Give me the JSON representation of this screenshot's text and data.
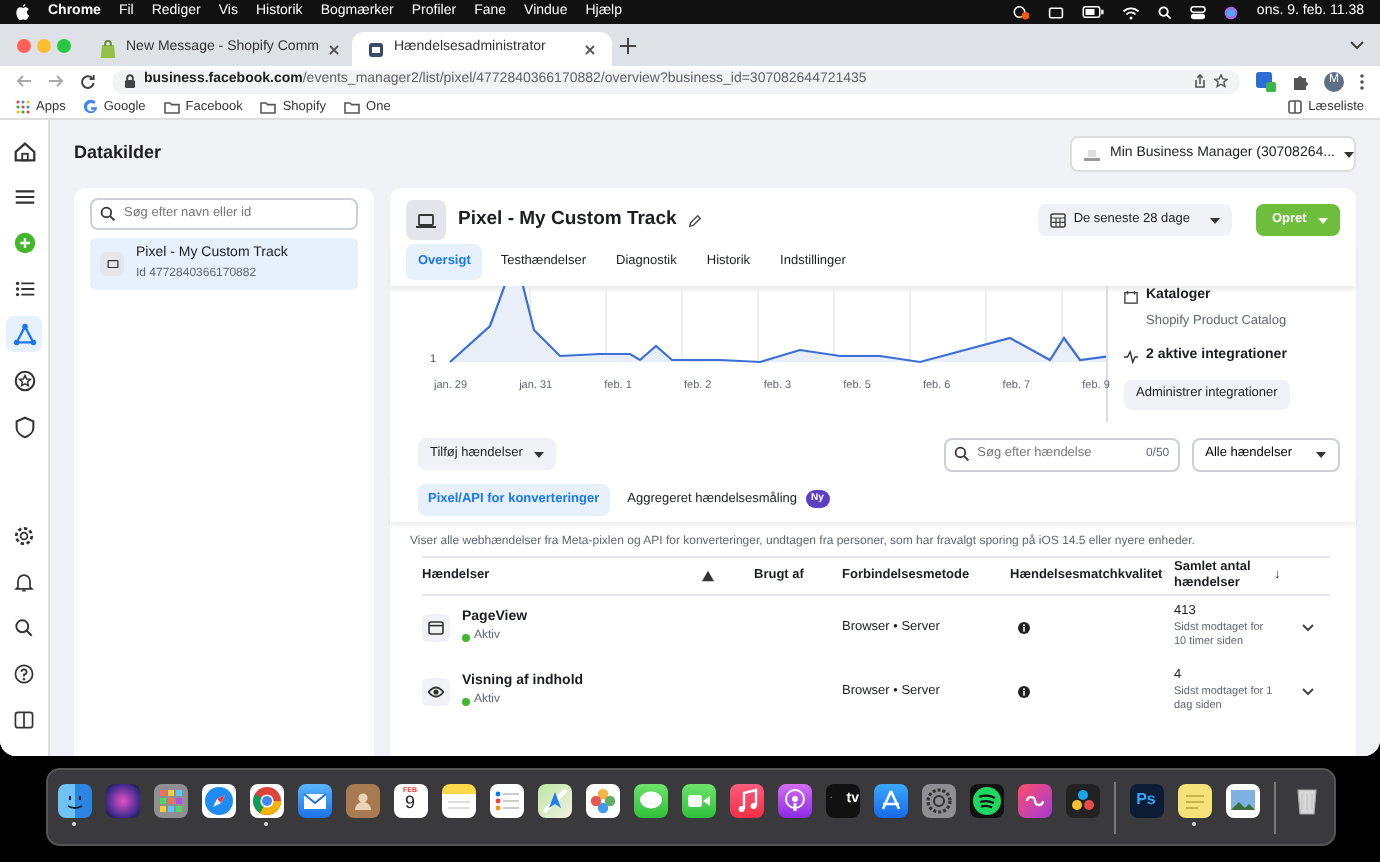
{
  "menu_bar": {
    "app": "Chrome",
    "items": [
      "Fil",
      "Rediger",
      "Vis",
      "Historik",
      "Bogmærker",
      "Profiler",
      "Fane",
      "Vindue",
      "Hjælp"
    ],
    "clock": "ons. 9. feb. 11.38"
  },
  "browser_tabs": [
    {
      "title": "New Message - Shopify Comm",
      "selected": false,
      "kind": "shopify"
    },
    {
      "title": "Hændelsesadministrator",
      "selected": true,
      "kind": "page"
    }
  ],
  "address": "**business.facebook.com**/events_manager2/list/pixel/4772840366170882/overview?business_id=307082644721435",
  "profile_initial": "M",
  "bookmarks": [
    {
      "label": "Apps",
      "kind": "apps"
    },
    {
      "label": "Google",
      "kind": "google"
    },
    {
      "label": "Facebook",
      "kind": "folder"
    },
    {
      "label": "Shopify",
      "kind": "folder"
    },
    {
      "label": "One",
      "kind": "folder"
    }
  ],
  "reading_list": "Læseliste",
  "rail": {
    "top": [
      {
        "kind": "home",
        "selected": false
      },
      {
        "kind": "menu",
        "selected": false
      },
      {
        "kind": "add",
        "selected": false
      },
      {
        "kind": "list",
        "selected": false
      },
      {
        "kind": "network",
        "selected": true
      },
      {
        "kind": "star",
        "selected": false
      },
      {
        "kind": "shield",
        "selected": false
      }
    ],
    "bottom": [
      {
        "kind": "settings"
      },
      {
        "kind": "bell"
      },
      {
        "kind": "search"
      },
      {
        "kind": "help"
      },
      {
        "kind": "panel"
      }
    ]
  },
  "page_title": "Datakilder",
  "business_selector": "Min Business Manager (30708264...",
  "sources": {
    "search_placeholder": "Søg efter navn eller id",
    "items": [
      {
        "name": "Pixel - My Custom Track",
        "id": "Id 4772840366170882",
        "selected": true
      }
    ]
  },
  "pixel": {
    "title": "Pixel - My Custom Track",
    "date_range": "De seneste 28 dage",
    "create": "Opret",
    "tabs": [
      {
        "label": "Oversigt",
        "selected": true
      },
      {
        "label": "Testhændelser",
        "selected": false
      },
      {
        "label": "Diagnostik",
        "selected": false
      },
      {
        "label": "Historik",
        "selected": false
      },
      {
        "label": "Indstillinger",
        "selected": false
      }
    ],
    "chart": {
      "y_label": "1",
      "x_labels": [
        "jan. 29",
        "jan. 31",
        "feb. 1",
        "feb. 2",
        "feb. 3",
        "feb. 5",
        "feb. 6",
        "feb. 7",
        "feb. 9"
      ]
    },
    "catalog_title": "Kataloger",
    "catalog_name": "Shopify Product Catalog",
    "integrations": "2 aktive integrationer",
    "manage_integrations": "Administrer integrationer",
    "add_events": "Tilføj hændelser",
    "event_search_placeholder": "Søg efter hændelse",
    "event_count": "0/50",
    "event_filter": "Alle hændelser",
    "sub_tabs": [
      {
        "label": "Pixel/API for konverteringer",
        "selected": true
      },
      {
        "label": "Aggregeret hændelsesmåling",
        "selected": false,
        "badge": "Ny"
      }
    ],
    "description": "Viser alle webhændelser fra Meta-pixlen og API for konverteringer, undtagen fra personer, som har fravalgt sporing på iOS 14.5 eller nyere enheder.",
    "table": {
      "columns": [
        {
          "label": "Hændelser"
        },
        {
          "kind": "warning"
        },
        {
          "label": "Brugt af"
        },
        {
          "label": "Forbindelsesmetode"
        },
        {
          "label": "Hændelsesmatchkvalitet"
        },
        {
          "label": "Samlet antal hændelser",
          "sort": "↓"
        }
      ],
      "rows": [
        {
          "kind": "window",
          "name": "PageView",
          "status": "Aktiv",
          "active": true,
          "method": "Browser • Server",
          "count": "413",
          "last": "Sidst modtaget for 10 timer siden"
        },
        {
          "kind": "eye",
          "name": "Visning af indhold",
          "status": "Aktiv",
          "active": true,
          "method": "Browser • Server",
          "count": "4",
          "last": "Sidst modtaget for 1 dag siden"
        }
      ]
    }
  },
  "dock": [
    {
      "kind": "finder",
      "running": true
    },
    {
      "kind": "siri",
      "running": false
    },
    {
      "kind": "launchpad",
      "running": false
    },
    {
      "kind": "safari",
      "running": false
    },
    {
      "kind": "chrome",
      "running": true
    },
    {
      "kind": "mail",
      "running": false
    },
    {
      "kind": "contacts",
      "running": false
    },
    {
      "kind": "calendar",
      "running": false,
      "month": "FEB",
      "day": "9"
    },
    {
      "kind": "notes",
      "running": false
    },
    {
      "kind": "reminders",
      "running": false
    },
    {
      "kind": "maps",
      "running": false
    },
    {
      "kind": "photos",
      "running": false
    },
    {
      "kind": "messages",
      "running": false
    },
    {
      "kind": "facetime",
      "running": false
    },
    {
      "kind": "music",
      "running": false
    },
    {
      "kind": "podcasts",
      "running": false
    },
    {
      "kind": "tv",
      "running": false,
      "label": "tv"
    },
    {
      "kind": "appstore",
      "running": false
    },
    {
      "kind": "settings",
      "running": false
    },
    {
      "kind": "spotify",
      "running": false
    },
    {
      "kind": "cloud",
      "running": false
    },
    {
      "kind": "resolve",
      "running": false
    },
    {
      "kind": "separator"
    },
    {
      "kind": "photoshop",
      "running": false,
      "label": "Ps"
    },
    {
      "kind": "stickies",
      "running": true
    },
    {
      "kind": "preview",
      "running": false
    },
    {
      "kind": "separator"
    },
    {
      "kind": "trash",
      "running": false
    }
  ]
}
